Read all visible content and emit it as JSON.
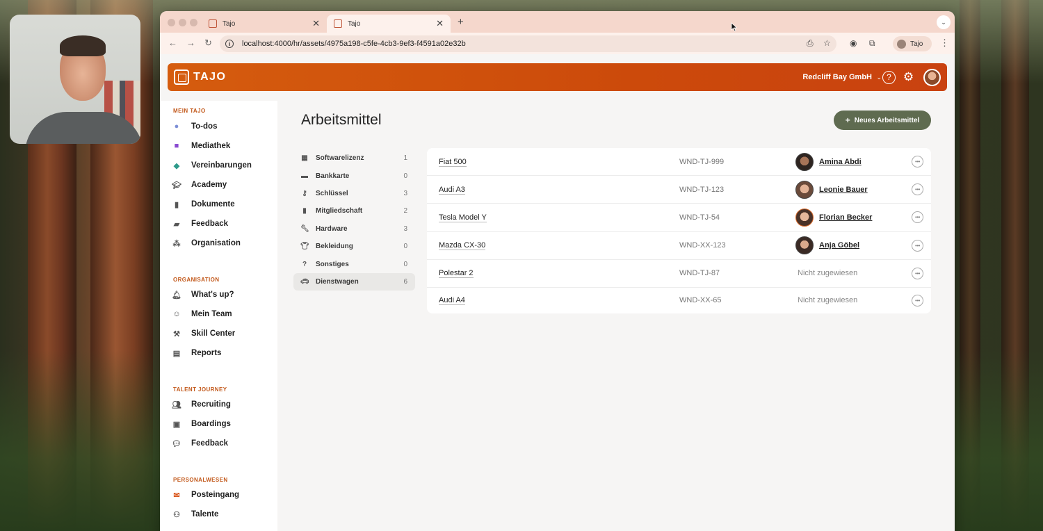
{
  "browser": {
    "tabs": [
      {
        "title": "Tajo",
        "active": false
      },
      {
        "title": "Tajo",
        "active": true
      }
    ],
    "url": "localhost:4000/hr/assets/4975a198-c5fe-4cb3-9ef3-f4591a02e32b",
    "profile_label": "Tajo"
  },
  "header": {
    "logo_text": "TAJO",
    "company": "Redcliff Bay GmbH"
  },
  "sidebar": {
    "sections": [
      {
        "title": "MEIN TAJO",
        "items": [
          "To-dos",
          "Mediathek",
          "Vereinbarungen",
          "Academy",
          "Dokumente",
          "Feedback",
          "Organisation"
        ]
      },
      {
        "title": "ORGANISATION",
        "items": [
          "What's up?",
          "Mein Team",
          "Skill Center",
          "Reports"
        ]
      },
      {
        "title": "TALENT JOURNEY",
        "items": [
          "Recruiting",
          "Boardings",
          "Feedback"
        ]
      },
      {
        "title": "PERSONALWESEN",
        "items": [
          "Posteingang",
          "Talente"
        ]
      }
    ]
  },
  "main": {
    "title": "Arbeitsmittel",
    "new_button": "Neues Arbeitsmittel",
    "categories": [
      {
        "label": "Softwarelizenz",
        "count": "1",
        "icon": "license-icon"
      },
      {
        "label": "Bankkarte",
        "count": "0",
        "icon": "card-icon"
      },
      {
        "label": "Schlüssel",
        "count": "3",
        "icon": "key-icon"
      },
      {
        "label": "Mitgliedschaft",
        "count": "2",
        "icon": "membership-icon"
      },
      {
        "label": "Hardware",
        "count": "3",
        "icon": "wrench-icon"
      },
      {
        "label": "Bekleidung",
        "count": "0",
        "icon": "shirt-icon"
      },
      {
        "label": "Sonstiges",
        "count": "0",
        "icon": "question-icon"
      },
      {
        "label": "Dienstwagen",
        "count": "6",
        "icon": "car-icon",
        "selected": true
      }
    ],
    "assets": [
      {
        "name": "Fiat 500",
        "plate": "WND-TJ-999",
        "assignee": "Amina Abdi"
      },
      {
        "name": "Audi A3",
        "plate": "WND-TJ-123",
        "assignee": "Leonie Bauer"
      },
      {
        "name": "Tesla Model Y",
        "plate": "WND-TJ-54",
        "assignee": "Florian Becker"
      },
      {
        "name": "Mazda CX-30",
        "plate": "WND-XX-123",
        "assignee": "Anja Göbel"
      },
      {
        "name": "Polestar 2",
        "plate": "WND-TJ-87",
        "assignee": "Nicht zugewiesen"
      },
      {
        "name": "Audi A4",
        "plate": "WND-XX-65",
        "assignee": "Nicht zugewiesen"
      }
    ]
  },
  "colors": {
    "header_orange": "#cc4a0b",
    "section_title": "#c2581a",
    "button_green": "#5f6b50"
  }
}
